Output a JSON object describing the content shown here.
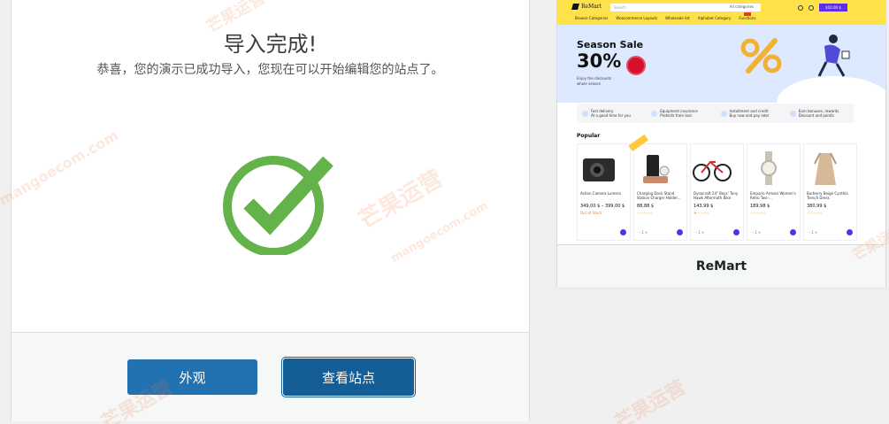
{
  "import": {
    "title": "导入完成!",
    "subtitle": "恭喜，您的演示已成功导入，您现在可以开始编辑您的站点了。",
    "buttons": {
      "appearance": "外观",
      "view_site": "查看站点"
    }
  },
  "theme_card": {
    "name": "ReMart",
    "preview": {
      "logo": "ReMart",
      "search_placeholder": "Search",
      "search_category": "All categories",
      "cart_label": "$10.00 $",
      "nav": [
        "Browse Categories",
        "Woocommerce Layouts",
        "Wholesale list",
        "Alphabet Category",
        "Functions"
      ],
      "hero": {
        "title": "Season Sale",
        "percent": "30%",
        "text": "Enjoy the discounts whole season"
      },
      "features": [
        {
          "title": "Fast delivery",
          "sub": "At a good time for you"
        },
        {
          "title": "Equipment insurance",
          "sub": "Protects from loss"
        },
        {
          "title": "Installment and credit",
          "sub": "Buy now and pay later"
        },
        {
          "title": "Earn bonuses, rewards",
          "sub": "Discount and points"
        }
      ],
      "popular_label": "Popular",
      "products": [
        {
          "name": "Action Camera Lumera",
          "price": "349,00 $ – 399,00 $",
          "extra": "Out of Stock"
        },
        {
          "name": "Charging Dock Stand Station Charger Holder...",
          "price": "88,88 $",
          "extra": ""
        },
        {
          "name": "Dynacraft 24\" Boys' Tony Hawk Aftermath Bike",
          "price": "143,99 $",
          "extra": ""
        },
        {
          "name": "Emporio Armani Women's Retro Two-...",
          "price": "189,98 $",
          "extra": ""
        },
        {
          "name": "Burberry Beige Cynthia Trench Dress",
          "price": "380,99 $",
          "extra": ""
        }
      ]
    }
  },
  "colors": {
    "accent": "#2271b1",
    "accent_dark": "#135e96",
    "check": "#63b24a",
    "brand_yellow": "#ffe24a",
    "brand_purple": "#5b2ee8"
  },
  "watermark": {
    "cn": "芒果运营",
    "en": "mangoecom.com"
  }
}
